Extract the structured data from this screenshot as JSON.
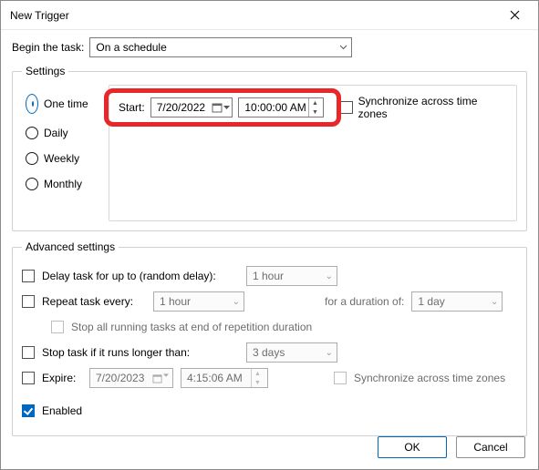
{
  "window": {
    "title": "New Trigger"
  },
  "begin": {
    "label": "Begin the task:",
    "value": "On a schedule"
  },
  "settings": {
    "legend": "Settings",
    "radios": {
      "one_time": "One time",
      "daily": "Daily",
      "weekly": "Weekly",
      "monthly": "Monthly",
      "selected": "one_time"
    },
    "start": {
      "label": "Start:",
      "date": "7/20/2022",
      "time": "10:00:00 AM",
      "sync_label": "Synchronize across time zones"
    }
  },
  "advanced": {
    "legend": "Advanced settings",
    "delay": {
      "label": "Delay task for up to (random delay):",
      "value": "1 hour"
    },
    "repeat": {
      "label": "Repeat task every:",
      "value": "1 hour",
      "duration_label": "for a duration of:",
      "duration_value": "1 day",
      "stop_label": "Stop all running tasks at end of repetition duration"
    },
    "stop_long": {
      "label": "Stop task if it runs longer than:",
      "value": "3 days"
    },
    "expire": {
      "label": "Expire:",
      "date": "7/20/2023",
      "time": "4:15:06 AM",
      "sync_label": "Synchronize across time zones"
    },
    "enabled": {
      "label": "Enabled",
      "checked": true
    }
  },
  "buttons": {
    "ok": "OK",
    "cancel": "Cancel"
  }
}
